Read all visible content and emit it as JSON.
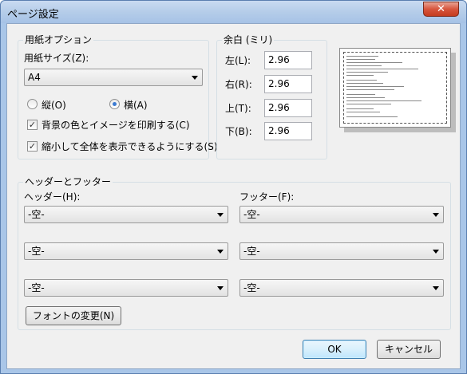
{
  "window": {
    "title": "ページ設定",
    "close": "✕"
  },
  "paper": {
    "group_title": "用紙オプション",
    "size_label": "用紙サイズ(Z):",
    "size_value": "A4",
    "portrait_label": "縦(O)",
    "landscape_label": "横(A)",
    "orientation": "landscape",
    "print_bg_label": "背景の色とイメージを印刷する(C)",
    "print_bg_checked": true,
    "shrink_label": "縮小して全体を表示できるようにする(S)",
    "shrink_checked": true
  },
  "margins": {
    "group_title": "余白 (ミリ)",
    "left_label": "左(L):",
    "left_value": "2.96",
    "right_label": "右(R):",
    "right_value": "2.96",
    "top_label": "上(T):",
    "top_value": "2.96",
    "bottom_label": "下(B):",
    "bottom_value": "2.96"
  },
  "header_footer": {
    "group_title": "ヘッダーとフッター",
    "header_label": "ヘッダー(H):",
    "footer_label": "フッター(F):",
    "header_values": [
      "-空-",
      "-空-",
      "-空-"
    ],
    "footer_values": [
      "-空-",
      "-空-",
      "-空-"
    ],
    "font_button": "フォントの変更(N)"
  },
  "buttons": {
    "ok": "OK",
    "cancel": "キャンセル"
  },
  "icons": {
    "check": "✓",
    "close": "close-icon",
    "dropdown": "chevron-down-icon"
  }
}
